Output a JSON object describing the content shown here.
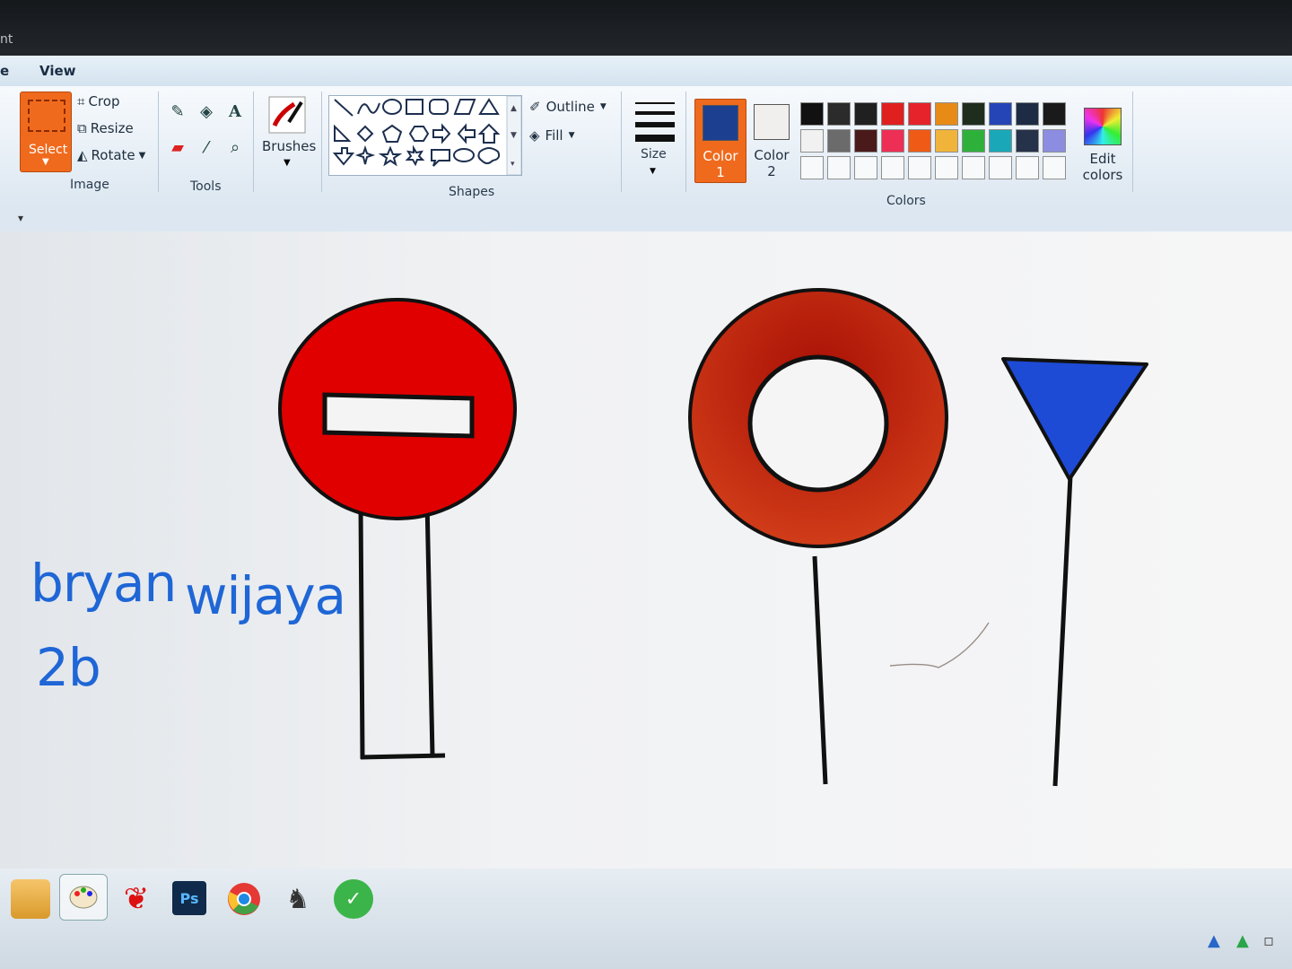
{
  "window": {
    "title_fragment": "nt"
  },
  "menu": {
    "tabs": [
      "e",
      "View"
    ]
  },
  "ribbon": {
    "image_group": {
      "label": "Image",
      "select": "Select",
      "crop": "Crop",
      "resize": "Resize",
      "rotate": "Rotate"
    },
    "tools_group": {
      "label": "Tools"
    },
    "brushes": {
      "label": "Brushes"
    },
    "shapes_group": {
      "label": "Shapes",
      "outline": "Outline",
      "fill": "Fill"
    },
    "size": {
      "label": "Size"
    },
    "colors_group": {
      "label": "Colors",
      "color1": {
        "label_line1": "Color",
        "label_line2": "1",
        "swatch": "#1d3f8f"
      },
      "color2": {
        "label_line1": "Color",
        "label_line2": "2",
        "swatch": "#f1eeee"
      },
      "edit_colors_line1": "Edit",
      "edit_colors_line2": "colors",
      "palette_row1": [
        "#111111",
        "#2b2b2b",
        "#202020",
        "#e01f1f",
        "#e6222b",
        "#e88a16",
        "#1f2d1f",
        "#2545b7",
        "#1d2b44",
        "#1a1a1a"
      ],
      "palette_row2": [
        "#f1f1f1",
        "#6b6b6b",
        "#4a1a1a",
        "#ee2f55",
        "#ef5b17",
        "#f1b43a",
        "#2eb13b",
        "#1aa8b8",
        "#26314a",
        "#8c8de0"
      ]
    }
  },
  "canvas": {
    "handwriting_line1_a": "bryan",
    "handwriting_line1_b": "wijaya",
    "handwriting_line2": "2b"
  },
  "taskbar": {
    "apps": [
      "file-explorer",
      "paint",
      "butterfly-app",
      "photoshop",
      "chrome",
      "chess",
      "corel"
    ],
    "photoshop_label": "Ps"
  },
  "accent": {
    "select_orange": "#f06a1d",
    "sign_red": "#e00000",
    "ring_red": "#c0300c",
    "triangle_blue": "#1d4bd6",
    "text_blue": "#1f66d6"
  }
}
